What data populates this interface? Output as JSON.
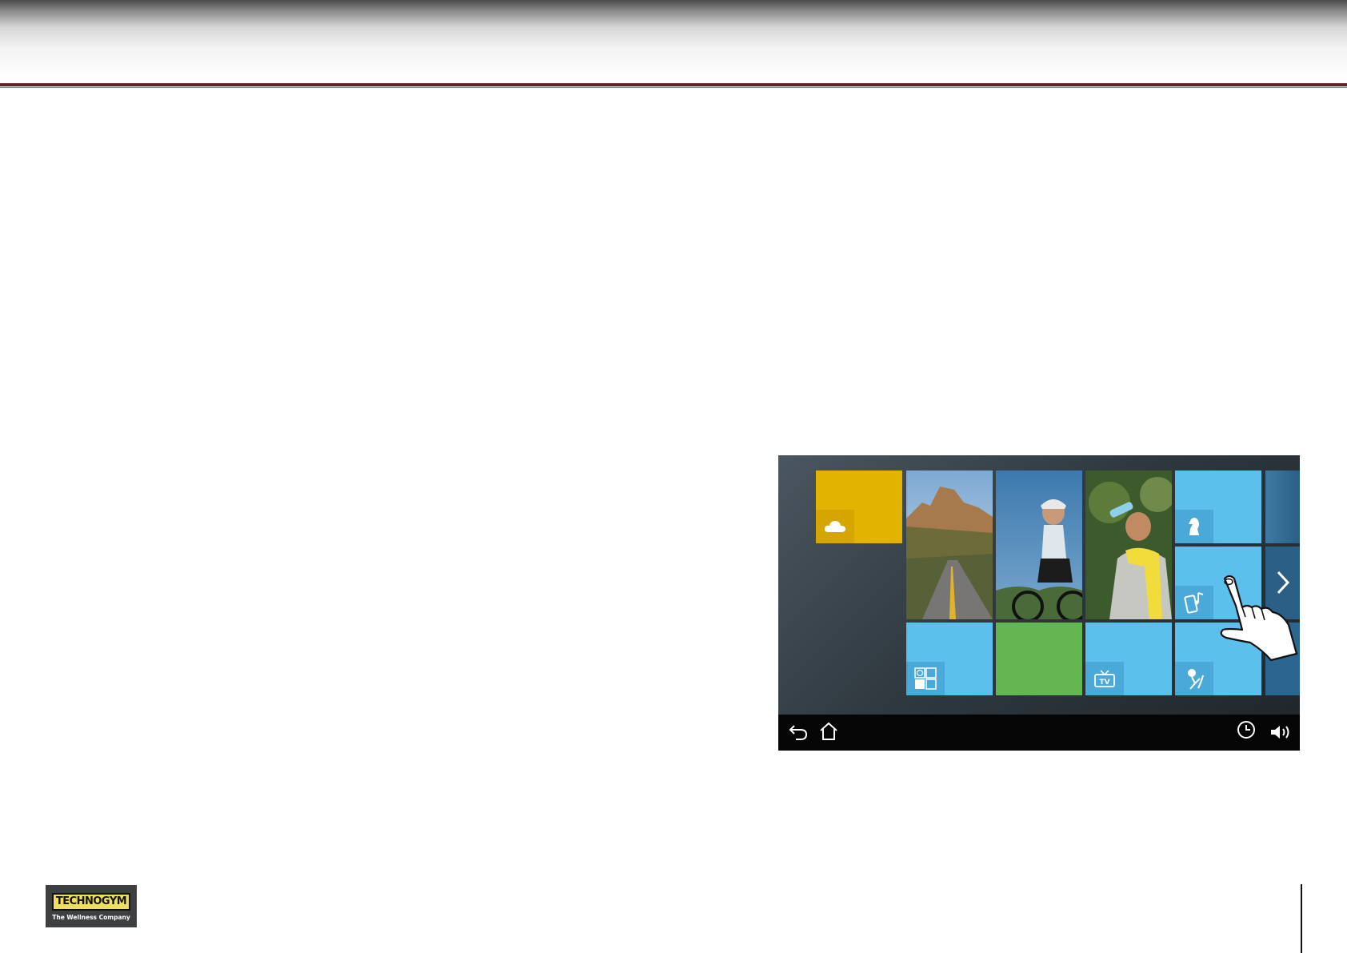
{
  "header": {
    "accent_color": "#5a2222"
  },
  "device_screen": {
    "tiles": [
      {
        "id": "weather",
        "icon": "cloud-icon",
        "color": "#e2b400"
      },
      {
        "id": "road-landscape",
        "image": "mountain road"
      },
      {
        "id": "cyclist",
        "image": "woman cycling"
      },
      {
        "id": "athlete-drinking",
        "image": "man drinking water"
      },
      {
        "id": "games",
        "icon": "chess-knight-icon",
        "color": "#5bc0ec"
      },
      {
        "id": "music",
        "icon": "phone-music-icon",
        "color": "#5bc0ec"
      },
      {
        "id": "workouts",
        "icon": "workout-grid-icon",
        "color": "#5bc0ec"
      },
      {
        "id": "green-tile",
        "color": "#64b652"
      },
      {
        "id": "tv",
        "icon": "tv-icon",
        "label": "TV",
        "color": "#5bc0ec"
      },
      {
        "id": "exercise",
        "icon": "runner-icon",
        "color": "#5bc0ec"
      }
    ],
    "navbar": {
      "left": [
        "back-icon",
        "home-icon"
      ],
      "right": [
        "clock-icon",
        "volume-icon"
      ]
    },
    "gesture": "tap-hand-icon"
  },
  "logo": {
    "brand": "TECHNOGYM",
    "tagline": "The Wellness Company"
  }
}
